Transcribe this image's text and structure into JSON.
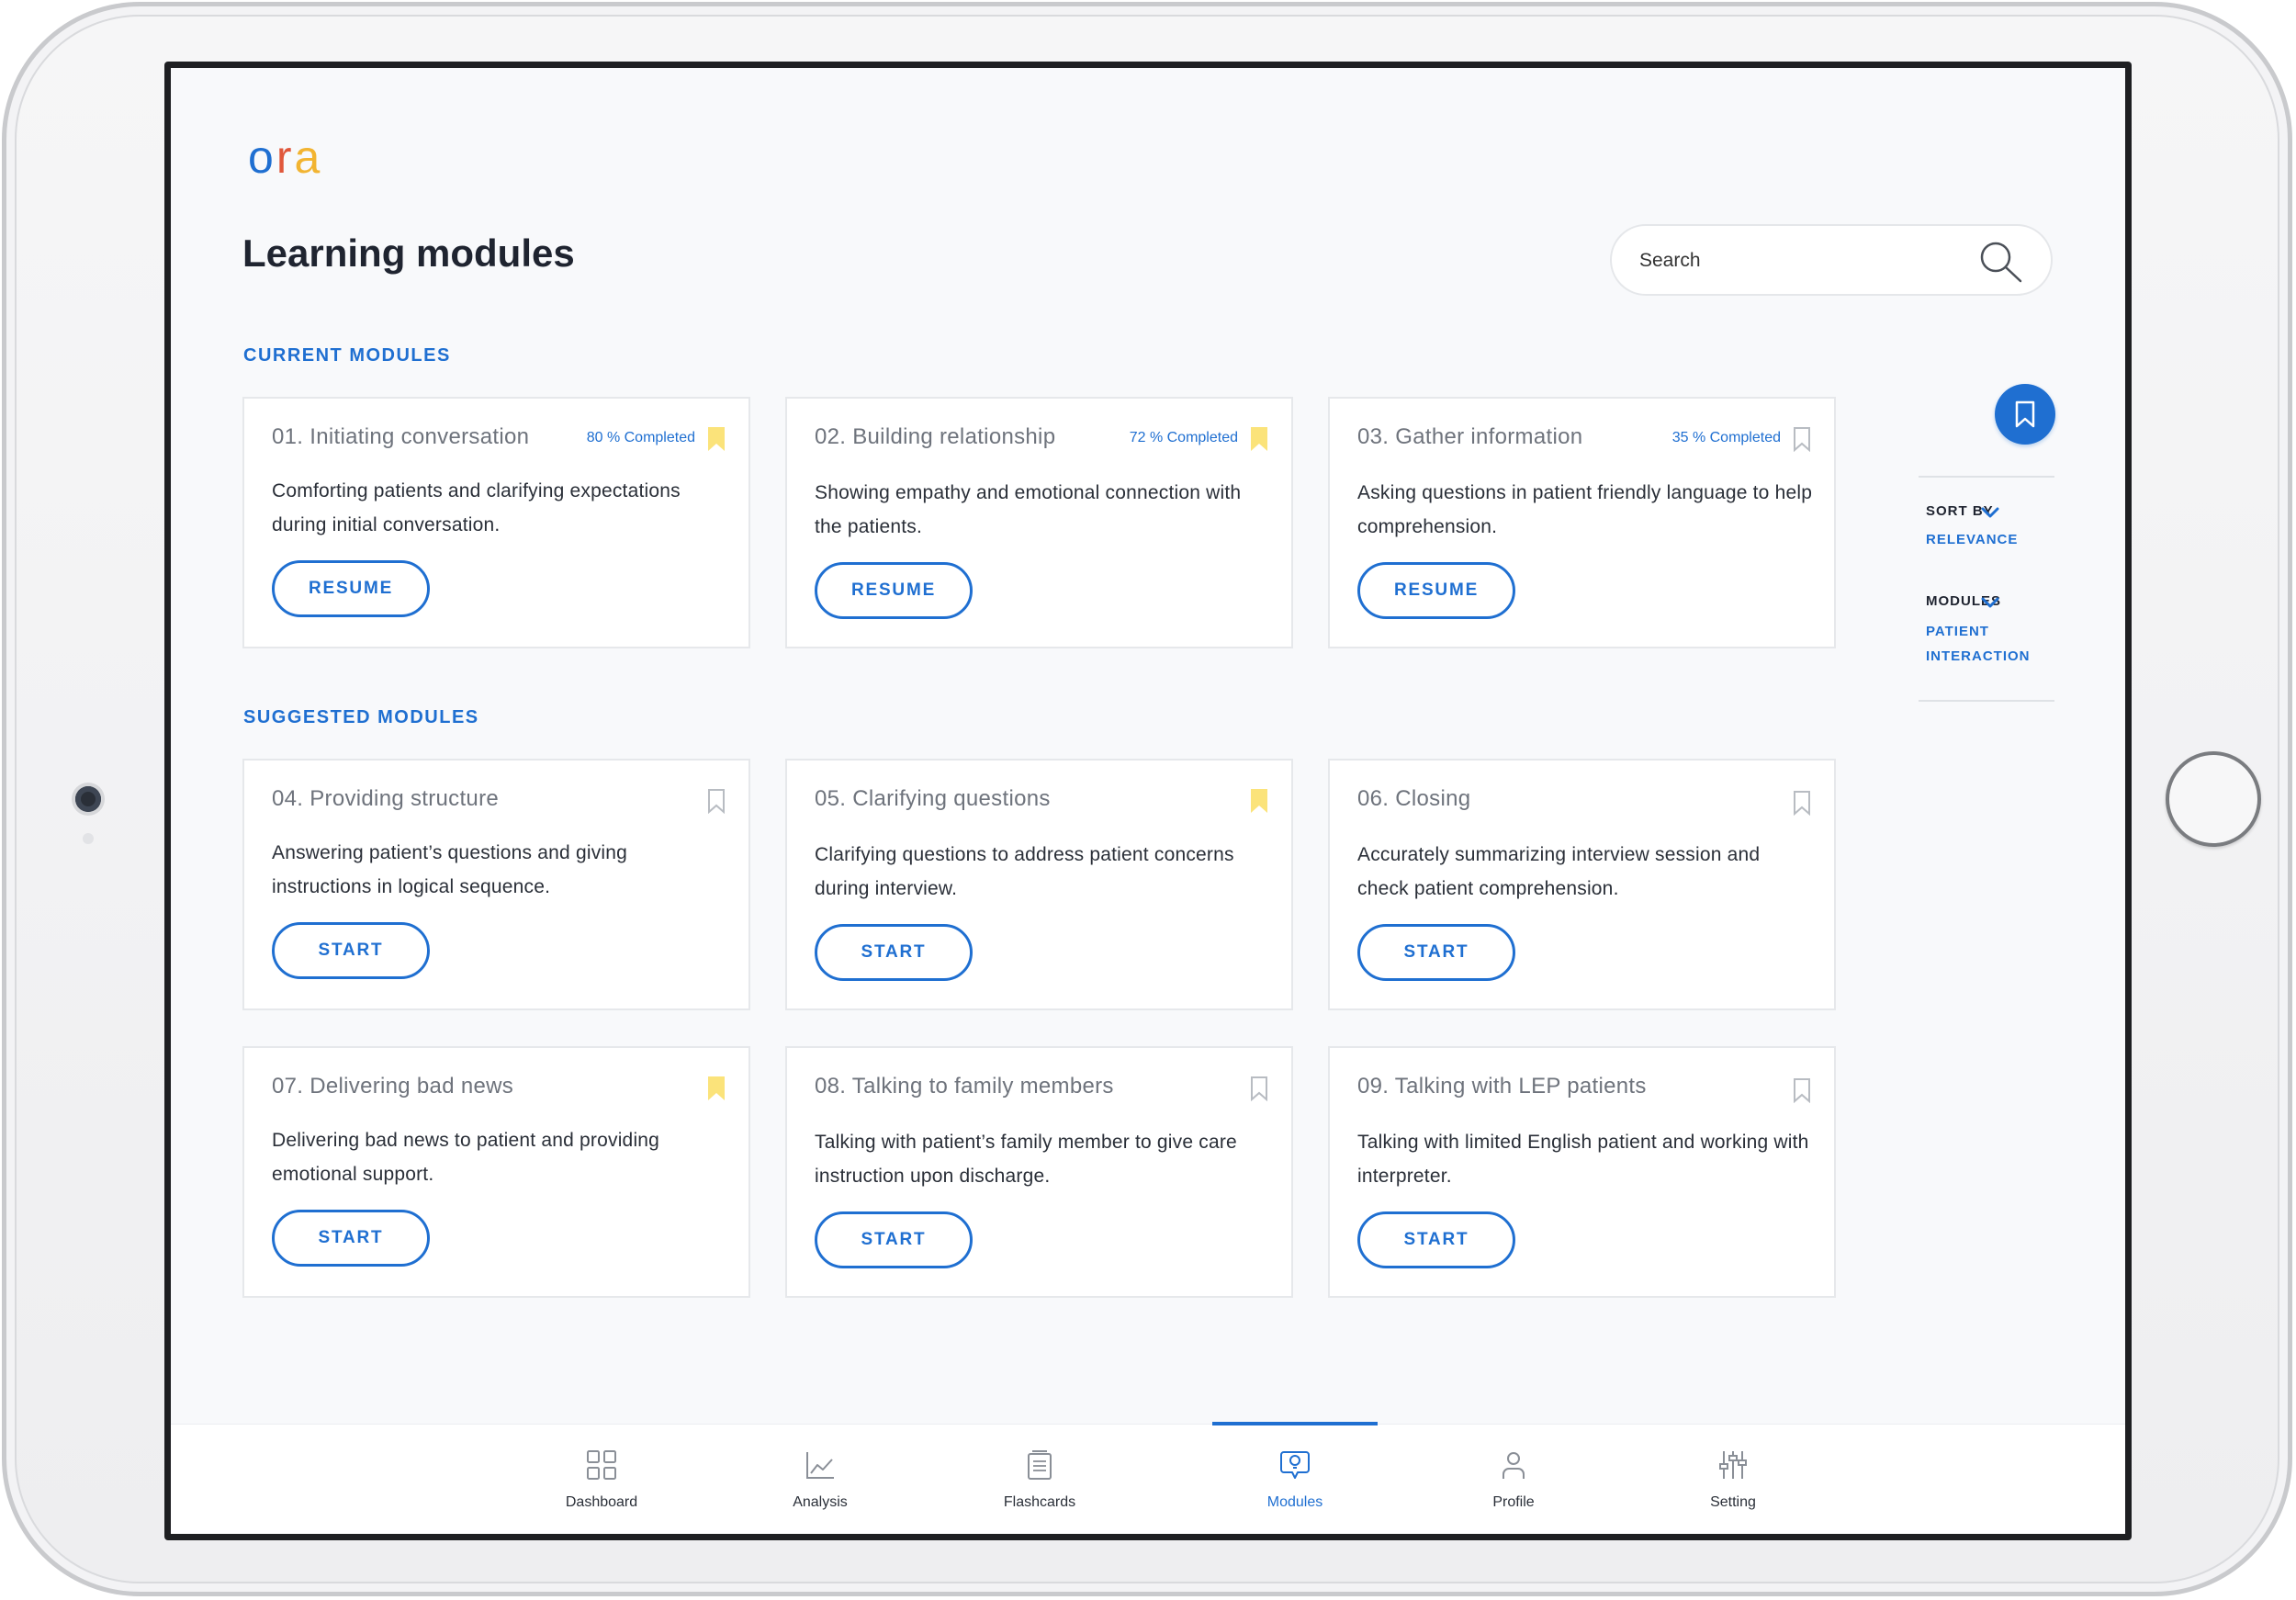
{
  "app": {
    "logo": {
      "o": "o",
      "r": "r",
      "a": "a"
    }
  },
  "colors": {
    "accent": "#1f6fd1",
    "bookmark_filled": "#fbe37a",
    "bookmark_outline": "#b8bcc2",
    "title_text": "#1f2430"
  },
  "header": {
    "title": "Learning modules"
  },
  "search": {
    "placeholder": "Search",
    "icon": "search-icon"
  },
  "sections": {
    "current": {
      "label": "CURRENT MODULES"
    },
    "suggested": {
      "label": "SUGGESTED MODULES"
    }
  },
  "current_modules": [
    {
      "title": "01. Initiating conversation",
      "progress": "80 % Completed",
      "bookmarked": true,
      "description": "Comforting patients and clarifying expectations during initial conversation.",
      "button": "RESUME"
    },
    {
      "title": "02. Building relationship",
      "progress": "72 % Completed",
      "bookmarked": true,
      "description": "Showing empathy and emotional connection with the patients.",
      "button": "RESUME"
    },
    {
      "title": "03. Gather information",
      "progress": "35 % Completed",
      "bookmarked": false,
      "description": "Asking questions in patient friendly language to help comprehension.",
      "button": "RESUME"
    }
  ],
  "suggested_modules": [
    {
      "title": "04. Providing structure",
      "bookmarked": false,
      "description": "Answering patient’s questions and giving instructions in logical sequence.",
      "button": "START"
    },
    {
      "title": "05. Clarifying questions",
      "bookmarked": true,
      "description": "Clarifying questions to address patient concerns during interview.",
      "button": "START"
    },
    {
      "title": "06. Closing",
      "bookmarked": false,
      "description": "Accurately summarizing interview session and check patient comprehension.",
      "button": "START"
    },
    {
      "title": "07. Delivering bad news",
      "bookmarked": true,
      "description": "Delivering bad news to patient and providing emotional support.",
      "button": "START"
    },
    {
      "title": "08. Talking to family members",
      "bookmarked": false,
      "description": "Talking with patient’s family member to give care instruction upon discharge.",
      "button": "START"
    },
    {
      "title": "09. Talking with LEP patients",
      "bookmarked": false,
      "description": "Talking with limited English patient and working with interpreter.",
      "button": "START"
    }
  ],
  "filters": {
    "sort_by": {
      "label": "SORT BY",
      "value": "RELEVANCE"
    },
    "modules": {
      "label": "MODULES",
      "value_line1": "PATIENT",
      "value_line2": "INTERACTION"
    }
  },
  "nav": {
    "active": "Modules",
    "items": [
      {
        "label": "Dashboard",
        "icon": "grid-icon"
      },
      {
        "label": "Analysis",
        "icon": "line-chart-icon"
      },
      {
        "label": "Flashcards",
        "icon": "flashcards-icon"
      },
      {
        "label": "Modules",
        "icon": "lightbulb-chat-icon"
      },
      {
        "label": "Profile",
        "icon": "person-icon"
      },
      {
        "label": "Setting",
        "icon": "sliders-icon"
      }
    ]
  }
}
